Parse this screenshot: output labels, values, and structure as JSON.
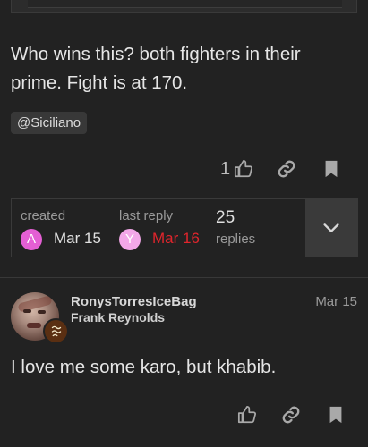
{
  "post1": {
    "body": "Who wins this? both fighters in their prime. Fight is at 170.",
    "mention": "@Siciliano",
    "like_count": "1"
  },
  "topic_map": {
    "created_label": "created",
    "created_avatar_letter": "A",
    "created_avatar_color": "#e45fd4",
    "created_date": "Mar 15",
    "last_reply_label": "last reply",
    "last_reply_avatar_letter": "Y",
    "last_reply_avatar_color": "#f2a7e8",
    "last_reply_date": "Mar 16",
    "last_reply_date_color": "#e0252c",
    "replies_count": "25",
    "replies_label": "replies"
  },
  "post2": {
    "username": "RonysTorresIceBag",
    "full_name": "Frank Reynolds",
    "date": "Mar 15",
    "body": "I love me some karo, but khabib."
  },
  "icons": [
    "like-icon",
    "link-icon",
    "bookmark-icon",
    "chevron-down-icon"
  ]
}
